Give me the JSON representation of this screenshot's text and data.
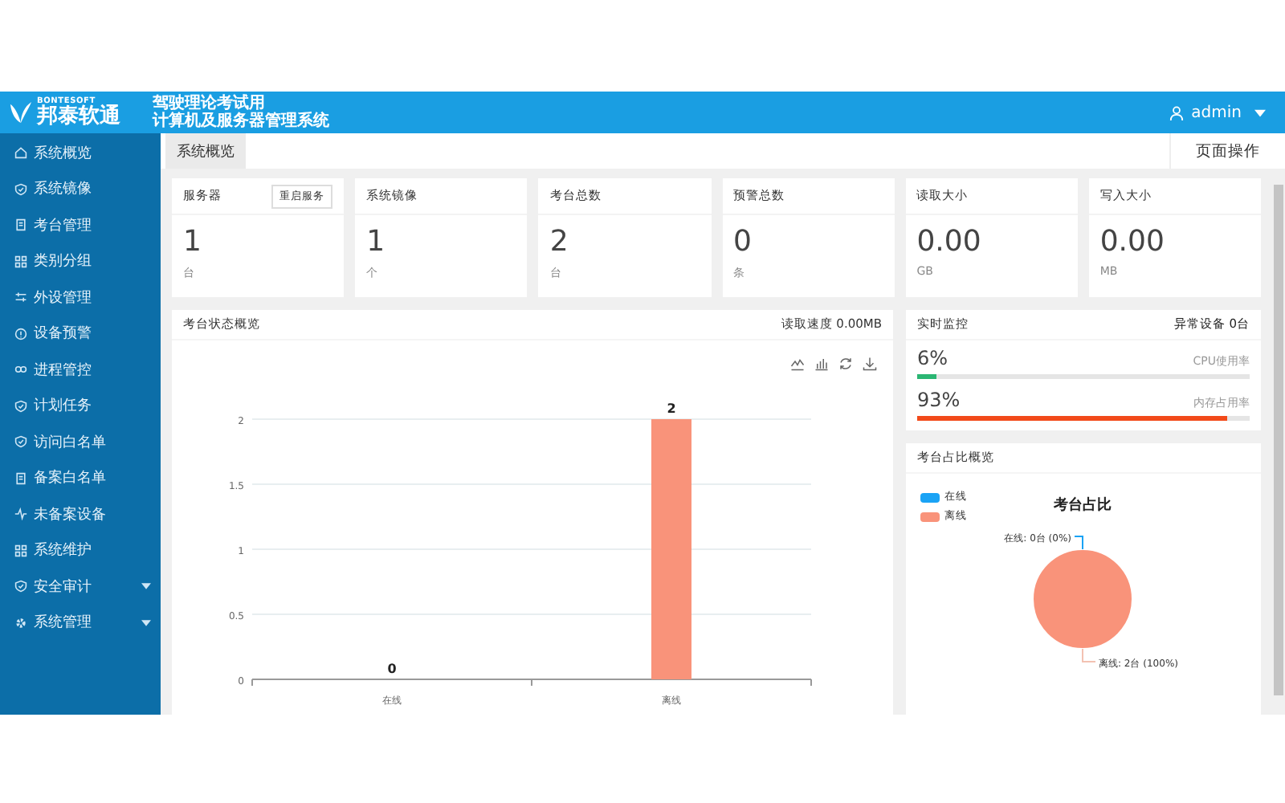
{
  "header": {
    "brand_small": "BONTESOFT",
    "brand": "邦泰软通",
    "title_lines": [
      "驾驶理论考试用",
      "计算机及服务器管理系统"
    ],
    "user": "admin"
  },
  "sidebar": {
    "items": [
      {
        "label": "系统概览",
        "selected": false
      },
      {
        "label": "系统镜像",
        "selected": false
      },
      {
        "label": "考台管理",
        "selected": false
      },
      {
        "label": "类别分组",
        "selected": false
      },
      {
        "label": "外设管理",
        "selected": false
      },
      {
        "label": "设备预警",
        "selected": false
      },
      {
        "label": "进程管控",
        "selected": false
      },
      {
        "label": "计划任务",
        "selected": false
      },
      {
        "label": "访问白名单",
        "selected": false
      },
      {
        "label": "备案白名单",
        "selected": false
      },
      {
        "label": "未备案设备",
        "selected": false
      },
      {
        "label": "系统维护",
        "selected": false
      },
      {
        "label": "安全审计",
        "selected": false,
        "expandable": true
      },
      {
        "label": "系统管理",
        "selected": false,
        "expandable": true
      }
    ]
  },
  "tabs": [
    {
      "label": "系统概览",
      "selected": true
    }
  ],
  "page_actions": "页面操作",
  "stat_cards": [
    {
      "label": "服务器",
      "button": "重启服务",
      "value": "1",
      "unit": "台"
    },
    {
      "label": "系统镜像",
      "value": "1",
      "unit": "个"
    },
    {
      "label": "考台总数",
      "value": "2",
      "unit": "台"
    },
    {
      "label": "预警总数",
      "value": "0",
      "unit": "条"
    },
    {
      "label": "读取大小",
      "value": "0.00",
      "unit": "GB"
    },
    {
      "label": "写入大小",
      "value": "0.00",
      "unit": "MB"
    }
  ],
  "status_panel": {
    "title": "考台状态概览",
    "read_speed": "读取速度 0.00MB",
    "chart_data": {
      "type": "bar",
      "categories": [
        "在线",
        "离线"
      ],
      "series": [
        {
          "color": "#f9937a",
          "values": [
            0,
            2
          ]
        }
      ],
      "ylim": [
        0,
        2
      ],
      "yticks": [
        0,
        0.5,
        1,
        1.5,
        2
      ],
      "grid": true,
      "data_labels": true
    }
  },
  "monitor_panel": {
    "title": "实时监控",
    "abnormal": "异常设备 0台",
    "meters": [
      {
        "reading": "6%",
        "label": "CPU使用率",
        "level": 0.06,
        "color": "#2bb673"
      },
      {
        "reading": "93%",
        "label": "内存占用率",
        "level": 0.93,
        "color": "#f24a1a"
      }
    ]
  },
  "share_panel": {
    "title": "考台占比概览",
    "legend": [
      {
        "color": "#1aa3f5"
      },
      {
        "color": "#f9937a"
      }
    ],
    "chart_data": {
      "type": "pie",
      "title": "考台占比",
      "categories": [
        "在线",
        "离线"
      ],
      "values": [
        0,
        100
      ],
      "annotations": [
        "在线: 0台 (0%)",
        "离线: 2台 (100%)"
      ]
    }
  }
}
